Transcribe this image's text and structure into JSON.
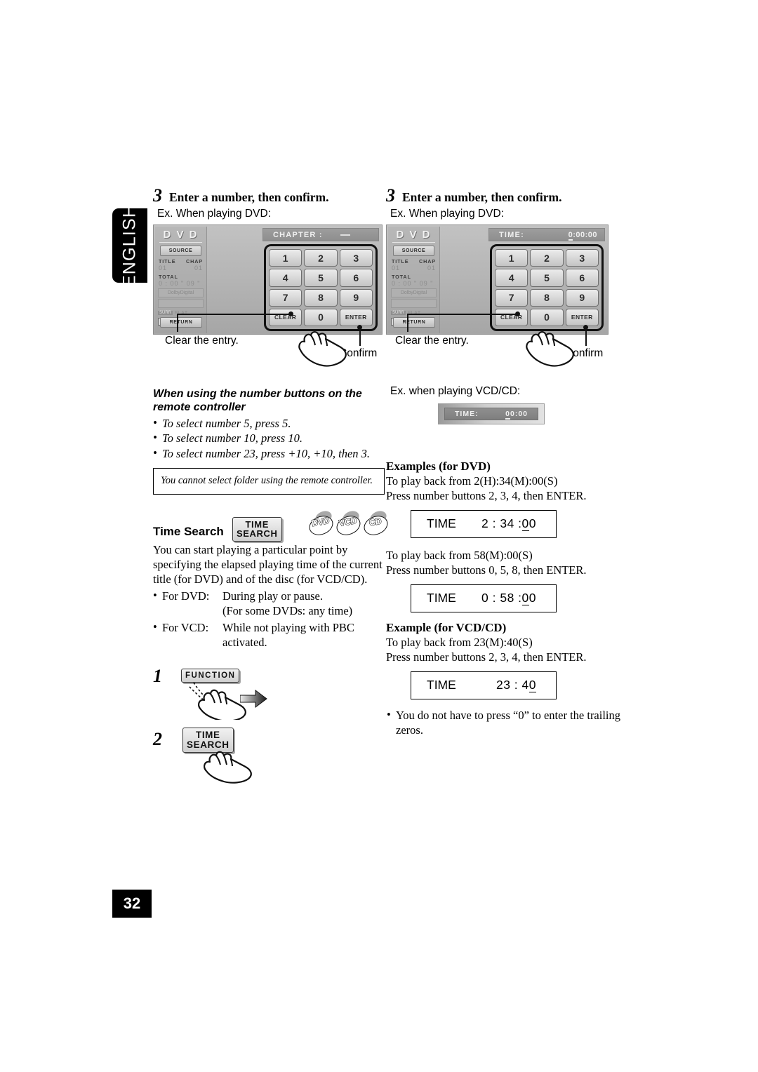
{
  "page": {
    "language_tab": "ENGLISH",
    "page_number": "32"
  },
  "left_column": {
    "step": {
      "number": "3",
      "title": "Enter a number, then confirm.",
      "example_caption": "Ex. When playing DVD:"
    },
    "screen": {
      "logo": "D V D",
      "source_button": "SOURCE",
      "title_label": "TITLE",
      "chap_label": "CHAP",
      "title_value": "01",
      "chap_value": "01",
      "total_label": "TOTAL",
      "total_value": "0 : 00 \" 09 \"",
      "audio_format": "DolbyDigital",
      "eq_tag": "SURR",
      "eq_mode": "FLAT",
      "digital_label": "Digital",
      "return_button": "RETURN",
      "pad_header_label": "CHAPTER :",
      "pad_header_value": "",
      "keys": [
        "1",
        "2",
        "3",
        "4",
        "5",
        "6",
        "7",
        "8",
        "9",
        "CLEAR",
        "0",
        "ENTER"
      ]
    },
    "callouts": {
      "clear": "Clear the entry.",
      "confirm": "Confirm"
    },
    "remote_section": {
      "heading": "When using the number buttons on the remote controller",
      "bullets": [
        "To select number 5, press 5.",
        "To select number 10, press 10.",
        "To select number 23, press +10, +10, then 3."
      ],
      "note": "You cannot select folder using the remote controller."
    },
    "time_search": {
      "title": "Time Search",
      "button_chip_line1": "TIME",
      "button_chip_line2": "SEARCH",
      "discs": [
        "DVD",
        "VCD",
        "CD"
      ],
      "paragraph": "You can start playing a particular point by specifying the elapsed playing time of the current title (for DVD) and of the disc (for VCD/CD).",
      "items": [
        {
          "term": "For DVD:",
          "def": "During play or pause.",
          "cont": "(For some DVDs: any time)"
        },
        {
          "term": "For VCD:",
          "def": "While not playing with PBC",
          "cont": "activated."
        }
      ]
    },
    "actions": [
      {
        "number": "1",
        "label": "FUNCTION"
      },
      {
        "number": "2",
        "label_line1": "TIME",
        "label_line2": "SEARCH"
      }
    ]
  },
  "right_column": {
    "step": {
      "number": "3",
      "title": "Enter a number, then confirm.",
      "example_caption": "Ex. When playing DVD:"
    },
    "screen": {
      "logo": "D V D",
      "source_button": "SOURCE",
      "title_label": "TITLE",
      "chap_label": "CHAP",
      "title_value": "01",
      "chap_value": "01",
      "total_label": "TOTAL",
      "total_value": "0 : 00 \" 09 \"",
      "audio_format": "DolbyDigital",
      "eq_tag": "SURR",
      "eq_mode": "FLAT",
      "digital_label": "Digital",
      "return_button": "RETURN",
      "pad_header_label": "TIME:",
      "pad_header_value_cursor": "0",
      "pad_header_value_rest": ":00:00",
      "keys": [
        "1",
        "2",
        "3",
        "4",
        "5",
        "6",
        "7",
        "8",
        "9",
        "CLEAR",
        "0",
        "ENTER"
      ]
    },
    "callouts": {
      "clear": "Clear the entry.",
      "confirm": "Confirm"
    },
    "vcd_example": {
      "caption": "Ex. when playing VCD/CD:",
      "strip_label": "TIME:",
      "strip_value_cursor": "0",
      "strip_value_rest": "0:00"
    },
    "examples_dvd": {
      "heading": "Examples (for DVD)",
      "case1_line1": "To play back from 2(H):34(M):00(S)",
      "case1_line2": "Press number buttons 2, 3, 4, then ENTER.",
      "case1_box_label": "TIME",
      "case1_box_value_plain": "2 : 34 :",
      "case1_box_value_cursor": "0",
      "case1_box_value_tail": "0",
      "case2_line1": "To play back from 58(M):00(S)",
      "case2_line2": "Press number buttons 0, 5, 8, then ENTER.",
      "case2_box_label": "TIME",
      "case2_box_value_plain": "0 : 58 :",
      "case2_box_value_cursor": "0",
      "case2_box_value_tail": "0"
    },
    "example_vcd": {
      "heading": "Example (for VCD/CD)",
      "line1": "To play back from 23(M):40(S)",
      "line2": "Press number buttons 2, 3, 4, then ENTER.",
      "box_label": "TIME",
      "box_value_plain": "23 : 4",
      "box_value_cursor": "0",
      "box_value_tail": ""
    },
    "trailing_note": "You do not have to press “0” to enter the trailing zeros."
  }
}
